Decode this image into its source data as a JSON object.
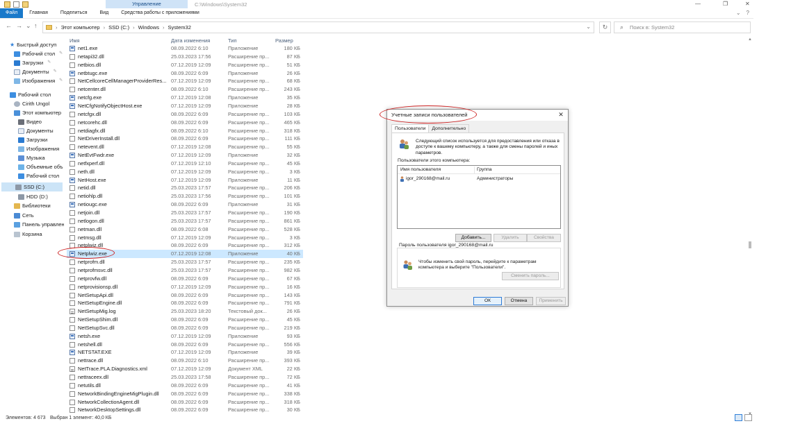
{
  "window": {
    "file_tab": "Файл",
    "tabs": [
      "Главная",
      "Поделиться",
      "Вид",
      "Средства работы с приложениями"
    ],
    "manage_tab": "Управление",
    "path_title": "C:\\Windows\\System32",
    "controls": {
      "minimize": "—",
      "maximize": "❐",
      "close": "✕"
    },
    "help": "?"
  },
  "address": {
    "back": "←",
    "forward": "→",
    "recent": "⌄",
    "up": "↑",
    "crumbs": [
      "Этот компьютер",
      "SSD (C:)",
      "Windows",
      "System32"
    ],
    "crumb_separator": "›",
    "dropdown": "⌄",
    "refresh": "↻",
    "search_placeholder": "Поиск в: System32"
  },
  "sidebar": {
    "items": [
      {
        "label": "Быстрый доступ",
        "icon": "star-icon",
        "pinned": false
      },
      {
        "label": "Рабочий стол",
        "icon": "desktop-icon",
        "pinned": true
      },
      {
        "label": "Загрузки",
        "icon": "downloads-icon",
        "pinned": true
      },
      {
        "label": "Документы",
        "icon": "documents-icon",
        "pinned": true
      },
      {
        "label": "Изображения",
        "icon": "pictures-icon",
        "pinned": true
      },
      {
        "label": "Рабочий стол",
        "icon": "desktop-icon",
        "pinned": false
      },
      {
        "label": "Cirith Ungol",
        "icon": "user-icon",
        "pinned": false
      },
      {
        "label": "Этот компьютер",
        "icon": "computer-icon",
        "pinned": false
      },
      {
        "label": "Видео",
        "icon": "video-icon",
        "pinned": false
      },
      {
        "label": "Документы",
        "icon": "documents-icon",
        "pinned": false
      },
      {
        "label": "Загрузки",
        "icon": "downloads-icon",
        "pinned": false
      },
      {
        "label": "Изображения",
        "icon": "pictures-icon",
        "pinned": false
      },
      {
        "label": "Музыка",
        "icon": "music-icon",
        "pinned": false
      },
      {
        "label": "Объемные объ",
        "icon": "3d-objects-icon",
        "pinned": false
      },
      {
        "label": "Рабочий стол",
        "icon": "desktop-icon",
        "pinned": false
      },
      {
        "label": "SSD (C:)",
        "icon": "drive-icon",
        "pinned": false
      },
      {
        "label": "HDD (D:)",
        "icon": "drive-icon",
        "pinned": false
      },
      {
        "label": "Библиотеки",
        "icon": "libraries-icon",
        "pinned": false
      },
      {
        "label": "Сеть",
        "icon": "network-icon",
        "pinned": false
      },
      {
        "label": "Панель управлен",
        "icon": "control-panel-icon",
        "pinned": false
      },
      {
        "label": "Корзина",
        "icon": "recycle-bin-icon",
        "pinned": false
      }
    ]
  },
  "columns": {
    "name": "Имя",
    "date": "Дата изменения",
    "type": "Тип",
    "size": "Размер"
  },
  "files": [
    {
      "name": "net1.exe",
      "date": "08.09.2022 6:10",
      "type": "Приложение",
      "size": "180 КБ"
    },
    {
      "name": "netapi32.dll",
      "date": "25.03.2023 17:56",
      "type": "Расширение пр...",
      "size": "87 КБ"
    },
    {
      "name": "netbios.dll",
      "date": "07.12.2019 12:09",
      "type": "Расширение пр...",
      "size": "51 КБ"
    },
    {
      "name": "netbtugc.exe",
      "date": "08.09.2022 6:09",
      "type": "Приложение",
      "size": "26 КБ"
    },
    {
      "name": "NetCellcoreCellManagerProviderRes...",
      "date": "07.12.2019 12:09",
      "type": "Расширение пр...",
      "size": "68 КБ"
    },
    {
      "name": "netcenter.dll",
      "date": "08.09.2022 6:10",
      "type": "Расширение пр...",
      "size": "243 КБ"
    },
    {
      "name": "netcfg.exe",
      "date": "07.12.2019 12:08",
      "type": "Приложение",
      "size": "35 КБ"
    },
    {
      "name": "NetCfgNotifyObjectHost.exe",
      "date": "07.12.2019 12:09",
      "type": "Приложение",
      "size": "28 КБ"
    },
    {
      "name": "netcfgx.dll",
      "date": "08.09.2022 6:09",
      "type": "Расширение пр...",
      "size": "103 КБ"
    },
    {
      "name": "netcorehc.dll",
      "date": "08.09.2022 6:09",
      "type": "Расширение пр...",
      "size": "465 КБ"
    },
    {
      "name": "netdiagfx.dll",
      "date": "08.09.2022 6:10",
      "type": "Расширение пр...",
      "size": "318 КБ"
    },
    {
      "name": "NetDriverInstall.dll",
      "date": "08.09.2022 6:09",
      "type": "Расширение пр...",
      "size": "111 КБ"
    },
    {
      "name": "netevent.dll",
      "date": "07.12.2019 12:08",
      "type": "Расширение пр...",
      "size": "55 КБ"
    },
    {
      "name": "NetEvtFwdr.exe",
      "date": "07.12.2019 12:09",
      "type": "Приложение",
      "size": "32 КБ"
    },
    {
      "name": "netfxperf.dll",
      "date": "07.12.2019 12:10",
      "type": "Расширение пр...",
      "size": "45 КБ"
    },
    {
      "name": "neth.dll",
      "date": "07.12.2019 12:09",
      "type": "Расширение пр...",
      "size": "3 КБ"
    },
    {
      "name": "NetHost.exe",
      "date": "07.12.2019 12:09",
      "type": "Приложение",
      "size": "11 КБ"
    },
    {
      "name": "netid.dll",
      "date": "25.03.2023 17:57",
      "type": "Расширение пр...",
      "size": "206 КБ"
    },
    {
      "name": "netiohlp.dll",
      "date": "25.03.2023 17:56",
      "type": "Расширение пр...",
      "size": "101 КБ"
    },
    {
      "name": "netiougc.exe",
      "date": "08.09.2022 6:09",
      "type": "Приложение",
      "size": "31 КБ"
    },
    {
      "name": "netjoin.dll",
      "date": "25.03.2023 17:57",
      "type": "Расширение пр...",
      "size": "190 КБ"
    },
    {
      "name": "netlogon.dll",
      "date": "25.03.2023 17:57",
      "type": "Расширение пр...",
      "size": "861 КБ"
    },
    {
      "name": "netman.dll",
      "date": "08.09.2022 6:08",
      "type": "Расширение пр...",
      "size": "528 КБ"
    },
    {
      "name": "netmsg.dll",
      "date": "07.12.2019 12:09",
      "type": "Расширение пр...",
      "size": "3 КБ"
    },
    {
      "name": "netplwiz.dll",
      "date": "08.09.2022 6:09",
      "type": "Расширение пр...",
      "size": "312 КБ"
    },
    {
      "name": "Netplwiz.exe",
      "date": "07.12.2019 12:08",
      "type": "Приложение",
      "size": "40 КБ"
    },
    {
      "name": "netprofm.dll",
      "date": "25.03.2023 17:57",
      "type": "Расширение пр...",
      "size": "235 КБ"
    },
    {
      "name": "netprofmsvc.dll",
      "date": "25.03.2023 17:57",
      "type": "Расширение пр...",
      "size": "982 КБ"
    },
    {
      "name": "netprovfw.dll",
      "date": "08.09.2022 6:09",
      "type": "Расширение пр...",
      "size": "67 КБ"
    },
    {
      "name": "netprovisionsp.dll",
      "date": "07.12.2019 12:09",
      "type": "Расширение пр...",
      "size": "16 КБ"
    },
    {
      "name": "NetSetupApi.dll",
      "date": "08.09.2022 6:09",
      "type": "Расширение пр...",
      "size": "143 КБ"
    },
    {
      "name": "NetSetupEngine.dll",
      "date": "08.09.2022 6:09",
      "type": "Расширение пр...",
      "size": "791 КБ"
    },
    {
      "name": "NetSetupMig.log",
      "date": "25.03.2023 18:20",
      "type": "Текстовый док...",
      "size": "26 КБ"
    },
    {
      "name": "NetSetupShim.dll",
      "date": "08.09.2022 6:09",
      "type": "Расширение пр...",
      "size": "45 КБ"
    },
    {
      "name": "NetSetupSvc.dll",
      "date": "08.09.2022 6:09",
      "type": "Расширение пр...",
      "size": "219 КБ"
    },
    {
      "name": "netsh.exe",
      "date": "07.12.2019 12:09",
      "type": "Приложение",
      "size": "93 КБ"
    },
    {
      "name": "netshell.dll",
      "date": "08.09.2022 6:09",
      "type": "Расширение пр...",
      "size": "556 КБ"
    },
    {
      "name": "NETSTAT.EXE",
      "date": "07.12.2019 12:09",
      "type": "Приложение",
      "size": "39 КБ"
    },
    {
      "name": "nettrace.dll",
      "date": "08.09.2022 6:10",
      "type": "Расширение пр...",
      "size": "393 КБ"
    },
    {
      "name": "NetTrace.PLA.Diagnostics.xml",
      "date": "07.12.2019 12:09",
      "type": "Документ XML",
      "size": "22 КБ"
    },
    {
      "name": "nettraceex.dll",
      "date": "25.03.2023 17:58",
      "type": "Расширение пр...",
      "size": "72 КБ"
    },
    {
      "name": "netutils.dll",
      "date": "08.09.2022 6:09",
      "type": "Расширение пр...",
      "size": "41 КБ"
    },
    {
      "name": "NetworkBindingEngineMigPlugin.dll",
      "date": "08.09.2022 6:09",
      "type": "Расширение пр...",
      "size": "338 КБ"
    },
    {
      "name": "NetworkCollectionAgent.dll",
      "date": "08.09.2022 6:09",
      "type": "Расширение пр...",
      "size": "318 КБ"
    },
    {
      "name": "NetworkDesktopSettings.dll",
      "date": "08.09.2022 6:09",
      "type": "Расширение пр...",
      "size": "30 КБ"
    }
  ],
  "selected_file": "Netplwiz.exe",
  "status": {
    "count": "Элементов: 4 673",
    "selection": "Выбран 1 элемент: 40,0 КБ"
  },
  "dialog": {
    "title": "Учетные записи пользователей",
    "close": "✕",
    "tabs": [
      "Пользователи",
      "Дополнительно"
    ],
    "intro": "Следующий список используется для предоставления или отказа в доступе к вашему компьютеру, а также для смены паролей и иных параметров.",
    "users_label": "Пользователи этого компьютера:",
    "list_headers": [
      "Имя пользователя",
      "Группа"
    ],
    "users": [
      {
        "name": "igor_290168@mail.ru",
        "group": "Администраторы"
      }
    ],
    "buttons": {
      "add": "Добавить...",
      "remove": "Удалить",
      "properties": "Свойства"
    },
    "password_group": "Пароль пользователя igor_290168@mail.ru",
    "password_text": "Чтобы изменить свой пароль, перейдите к параметрам компьютера и выберите \"Пользователи\".",
    "change_password": "Сменить пароль...",
    "ok": "ОК",
    "cancel": "Отмена",
    "apply": "Применить"
  },
  "colors": {
    "accent": "#1979ca",
    "selection": "#cce8ff",
    "annotation": "#cc2222"
  }
}
